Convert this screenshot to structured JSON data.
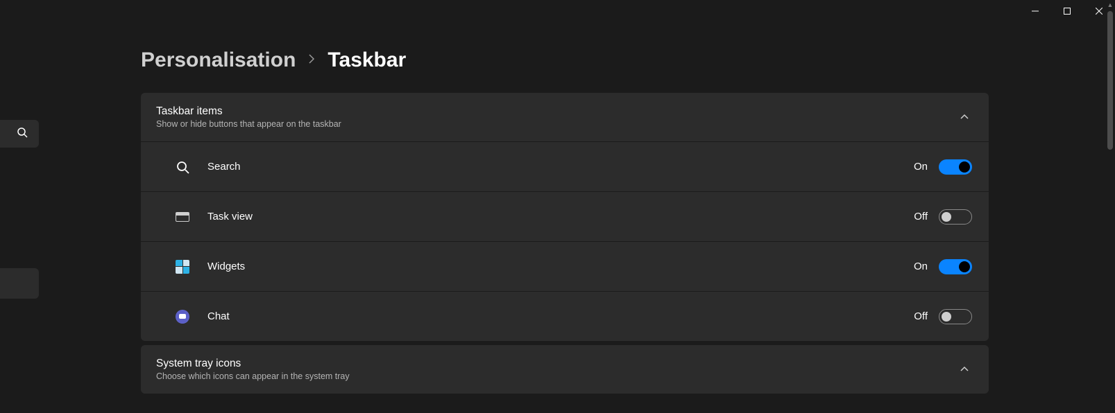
{
  "breadcrumb": {
    "parent": "Personalisation",
    "current": "Taskbar"
  },
  "sections": {
    "taskbar_items": {
      "title": "Taskbar items",
      "subtitle": "Show or hide buttons that appear on the taskbar",
      "rows": [
        {
          "label": "Search",
          "state": "On",
          "on": true
        },
        {
          "label": "Task view",
          "state": "Off",
          "on": false
        },
        {
          "label": "Widgets",
          "state": "On",
          "on": true
        },
        {
          "label": "Chat",
          "state": "Off",
          "on": false
        }
      ]
    },
    "system_tray": {
      "title": "System tray icons",
      "subtitle": "Choose which icons can appear in the system tray"
    }
  }
}
